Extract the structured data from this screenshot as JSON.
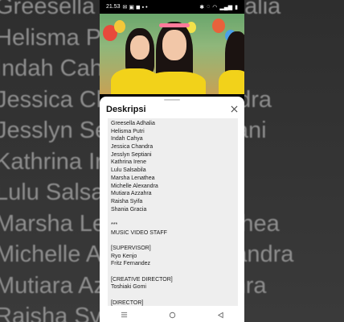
{
  "background_names": [
    "Greesella Adhalia",
    "Helisma Putri",
    "Indah Cahya",
    "Jessica Chandra",
    "Jesslyn Septiani",
    "Kathrina Irene",
    "Lulu Salsabila",
    "Marsha Lenathea",
    "Michelle Alexandra",
    "Mutiara Azzahra",
    "Raisha Syifa"
  ],
  "status_bar": {
    "time": "21.53",
    "battery": "▮"
  },
  "sheet": {
    "title": "Deskripsi"
  },
  "description": {
    "lines": [
      "Greesella Adhalia",
      "Helisma Putri",
      "Indah Cahya",
      "Jessica Chandra",
      "Jesslyn Septiani",
      "Kathrina Irene",
      "Lulu Salsabila",
      "Marsha Lenathea",
      "Michelle Alexandra",
      "Mutiara Azzahra",
      "Raisha Syifa",
      "Shania Gracia",
      "",
      "***",
      "MUSIC VIDEO STAFF",
      "",
      "[SUPERVISOR]",
      "Ryo Kenjo",
      "Fritz Fernandez",
      "",
      "[CREATIVE DIRECTOR]",
      "Toshiaki Gomi",
      "",
      "[DIRECTOR]"
    ]
  },
  "icons": {
    "close": "close-icon",
    "nav_recents": "menu-icon",
    "nav_home": "circle-icon",
    "nav_back": "back-triangle-icon"
  },
  "colors": {
    "sheet_bg": "#ffffff",
    "description_bg": "#eeeeee",
    "dress_yellow": "#f2d21a"
  }
}
